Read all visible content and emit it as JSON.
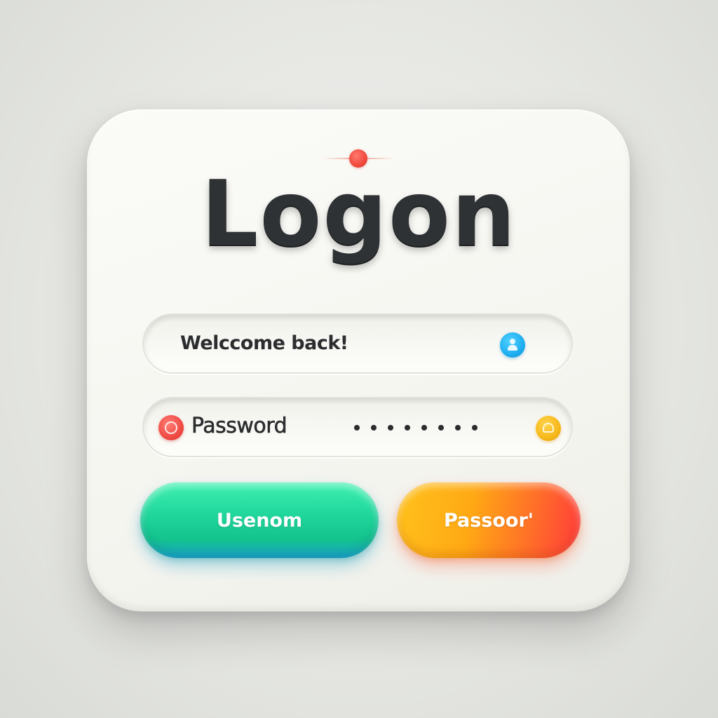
{
  "title": "Logon",
  "fields": {
    "username": {
      "value": "Welccome back!",
      "icon": "user-icon"
    },
    "password": {
      "label": "Password",
      "masked_value": "••••••••",
      "left_icon": "record-icon",
      "right_icon": "lock-icon"
    }
  },
  "buttons": {
    "primary_label": "Usenom",
    "secondary_label": "Passoor'"
  },
  "colors": {
    "accent_red": "#f04a44",
    "accent_blue": "#1eaef0",
    "accent_yellow": "#f7b81a",
    "button_green": "#1fd59a",
    "button_orange": "#ff8a1e"
  }
}
